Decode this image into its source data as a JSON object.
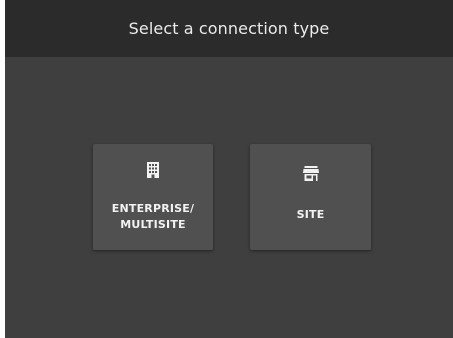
{
  "header": {
    "title": "Select a connection type"
  },
  "options": [
    {
      "icon": "building-icon",
      "label_lines": [
        "ENTERPRISE/",
        "MULTISITE"
      ]
    },
    {
      "icon": "store-icon",
      "label_lines": [
        "SITE"
      ]
    }
  ],
  "colors": {
    "background": "#3f3f3f",
    "header_background": "#2b2b2b",
    "card_background": "#505050",
    "text": "#f2f2f2"
  }
}
